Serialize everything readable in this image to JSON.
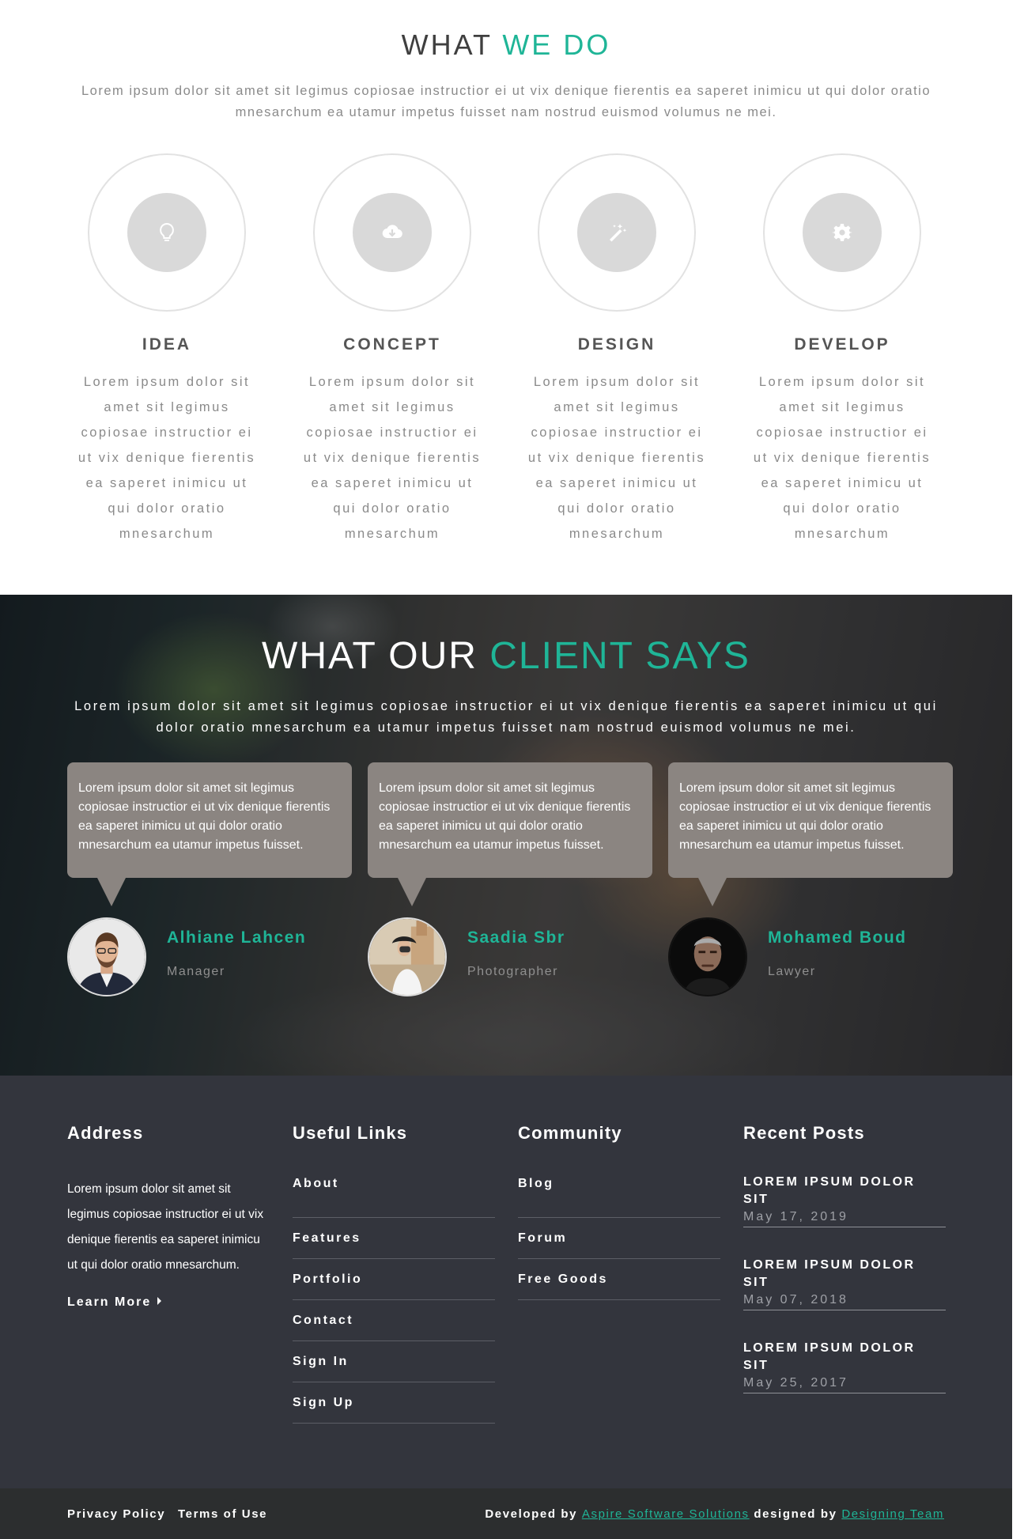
{
  "what_we_do": {
    "title_main": "WHAT",
    "title_accent": "WE DO",
    "intro": "Lorem ipsum dolor sit amet sit legimus copiosae instructior ei ut vix denique fierentis ea saperet inimicu ut qui dolor oratio mnesarchum ea utamur impetus fuisset nam nostrud euismod volumus ne mei.",
    "services": [
      {
        "title": "IDEA",
        "icon": "lightbulb-icon",
        "description": "Lorem ipsum dolor sit amet sit legimus copiosae instructior ei ut vix denique fierentis ea saperet inimicu ut qui dolor oratio mnesarchum"
      },
      {
        "title": "CONCEPT",
        "icon": "cloud-download-icon",
        "description": "Lorem ipsum dolor sit amet sit legimus copiosae instructior ei ut vix denique fierentis ea saperet inimicu ut qui dolor oratio mnesarchum"
      },
      {
        "title": "DESIGN",
        "icon": "magic-wand-icon",
        "description": "Lorem ipsum dolor sit amet sit legimus copiosae instructior ei ut vix denique fierentis ea saperet inimicu ut qui dolor oratio mnesarchum"
      },
      {
        "title": "DEVELOP",
        "icon": "gear-icon",
        "description": "Lorem ipsum dolor sit amet sit legimus copiosae instructior ei ut vix denique fierentis ea saperet inimicu ut qui dolor oratio mnesarchum"
      }
    ]
  },
  "testimonials": {
    "title_main": "WHAT OUR",
    "title_accent": "CLIENT SAYS",
    "intro": "Lorem ipsum dolor sit amet sit legimus copiosae instructior ei ut vix denique fierentis ea saperet inimicu ut qui dolor oratio mnesarchum ea utamur impetus fuisset nam nostrud euismod volumus ne mei.",
    "clients": [
      {
        "quote": "Lorem ipsum dolor sit amet sit legimus copiosae instructior ei ut vix denique fierentis ea saperet inimicu ut qui dolor oratio mnesarchum ea utamur impetus fuisset.",
        "name": "Alhiane Lahcen",
        "role": "Manager"
      },
      {
        "quote": "Lorem ipsum dolor sit amet sit legimus copiosae instructior ei ut vix denique fierentis ea saperet inimicu ut qui dolor oratio mnesarchum ea utamur impetus fuisset.",
        "name": "Saadia Sbr",
        "role": "Photographer"
      },
      {
        "quote": "Lorem ipsum dolor sit amet sit legimus copiosae instructior ei ut vix denique fierentis ea saperet inimicu ut qui dolor oratio mnesarchum ea utamur impetus fuisset.",
        "name": "Mohamed Boud",
        "role": "Lawyer"
      }
    ]
  },
  "footer": {
    "address": {
      "heading": "Address",
      "text": "Lorem ipsum dolor sit amet sit legimus copiosae instructior ei ut vix denique fierentis ea saperet inimicu ut qui dolor oratio mnesarchum.",
      "learn_more": "Learn More"
    },
    "useful_links": {
      "heading": "Useful Links",
      "items": [
        "About",
        "Features",
        "Portfolio",
        "Contact",
        "Sign In",
        "Sign Up"
      ]
    },
    "community": {
      "heading": "Community",
      "items": [
        "Blog",
        "Forum",
        "Free Goods"
      ]
    },
    "recent_posts": {
      "heading": "Recent Posts",
      "items": [
        {
          "title": "LOREM IPSUM DOLOR SIT",
          "date": "May 17, 2019"
        },
        {
          "title": "LOREM IPSUM DOLOR SIT",
          "date": "May 07, 2018"
        },
        {
          "title": "LOREM IPSUM DOLOR SIT",
          "date": "May 25, 2017"
        }
      ]
    }
  },
  "bottom_bar": {
    "privacy": "Privacy Policy",
    "terms": "Terms of Use",
    "developed_by": "Developed by",
    "developer": "Aspire Software Solutions",
    "designed_by": "designed by",
    "designer": "Designing Team"
  },
  "colors": {
    "accent": "#1fb597",
    "footer_bg": "#33353d",
    "bubble_bg": "#8b8581"
  }
}
